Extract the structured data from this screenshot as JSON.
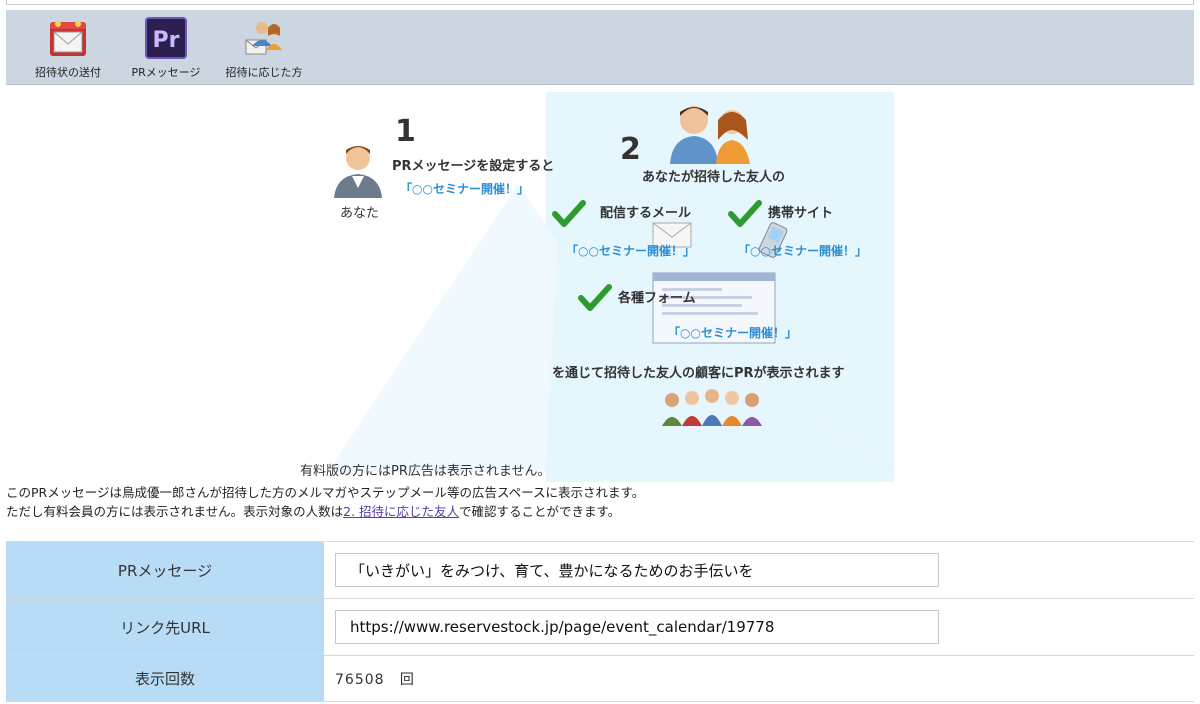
{
  "toolbar": {
    "items": [
      {
        "label": "招待状の送付",
        "icon": "invitation-envelope-icon"
      },
      {
        "label": "PRメッセージ",
        "icon": "pr-app-icon",
        "icon_text": "Pr"
      },
      {
        "label": "招待に応じた方",
        "icon": "people-envelope-icon"
      }
    ]
  },
  "illustration": {
    "step1": {
      "number": "1",
      "text": "PRメッセージを設定すると",
      "sample": "「○○セミナー開催！」",
      "you_label": "あなた"
    },
    "step2": {
      "number": "2",
      "heading": "あなたが招待した友人の",
      "mail_label": "配信するメール",
      "mail_sample": "「○○セミナー開催！」",
      "mobile_label": "携帯サイト",
      "mobile_sample": "「○○セミナー開催！」",
      "form_label": "各種フォーム",
      "form_sample": "「○○セミナー開催！」",
      "result": "を通じて招待した友人の顧客にPRが表示されます"
    },
    "note": "有料版の方にはPR広告は表示されません。"
  },
  "description": {
    "line1": "このPRメッセージは鳥成優一郎さんが招待した方のメルマガやステップメール等の広告スペースに表示されます。",
    "line2_before": "ただし有料会員の方には表示されません。表示対象の人数は",
    "line2_link": "2. 招待に応じた友人",
    "line2_after": "で確認することができます。"
  },
  "form": {
    "pr_label": "PRメッセージ",
    "pr_value": "「いきがい」をみつけ、育て、豊かになるためのお手伝いを",
    "url_label": "リンク先URL",
    "url_value": "https://www.reservestock.jp/page/event_calendar/19778",
    "count_label": "表示回数",
    "count_value": "76508",
    "count_unit": "回"
  },
  "colors": {
    "toolbar_bg": "#ccd6e0",
    "panel_bg": "#e6f6fd",
    "header_cell": "#b8dcf6",
    "accent_blue": "#2b8fd6",
    "check_green": "#2e9b2e"
  }
}
